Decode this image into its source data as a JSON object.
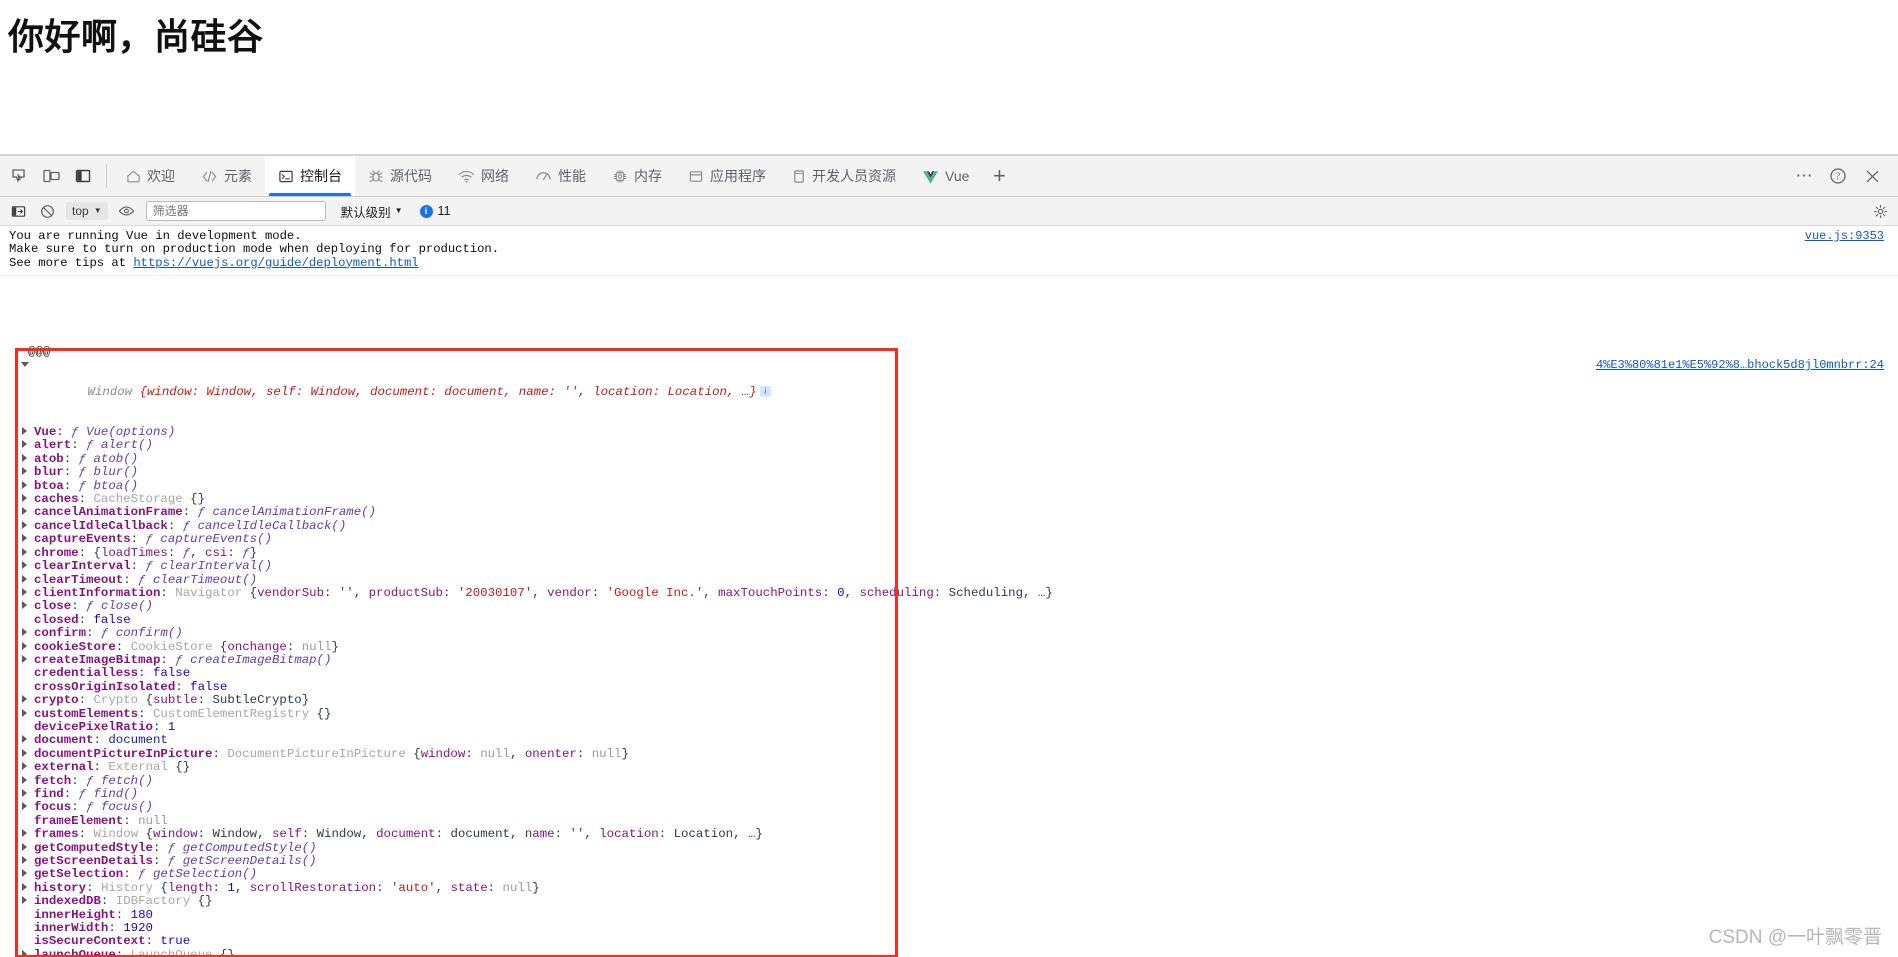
{
  "page": {
    "heading": "你好啊，尚硅谷"
  },
  "devtools": {
    "left_icons": [
      {
        "name": "inspect-element-icon",
        "label": "检查元素"
      },
      {
        "name": "device-toolbar-icon",
        "label": "切换设备工具栏"
      },
      {
        "name": "dock-side-icon",
        "label": "停靠位置"
      }
    ],
    "tabs": [
      {
        "label": "欢迎",
        "icon": "home-icon",
        "active": false
      },
      {
        "label": "元素",
        "icon": "code-brackets-icon",
        "active": false
      },
      {
        "label": "控制台",
        "icon": "console-prompt-icon",
        "active": true
      },
      {
        "label": "源代码",
        "icon": "bug-icon",
        "active": false
      },
      {
        "label": "网络",
        "icon": "wifi-icon",
        "active": false
      },
      {
        "label": "性能",
        "icon": "speedometer-icon",
        "active": false
      },
      {
        "label": "内存",
        "icon": "chip-icon",
        "active": false
      },
      {
        "label": "应用程序",
        "icon": "window-icon",
        "active": false
      },
      {
        "label": "开发人员资源",
        "icon": "book-icon",
        "active": false
      },
      {
        "label": "Vue",
        "icon": "vue-logo-icon",
        "active": false
      }
    ],
    "add_tab_label": "+",
    "right_buttons": [
      {
        "name": "more-options-button",
        "label": "⋯"
      },
      {
        "name": "help-button",
        "label": "?"
      },
      {
        "name": "close-devtools-button",
        "label": "✕"
      }
    ],
    "settings_icon": "gear-icon"
  },
  "console_toolbar": {
    "sidebar_icon": "console-sidebar-icon",
    "clear_icon": "clear-console-icon",
    "context_value": "top",
    "eye_icon": "live-expression-icon",
    "filter_placeholder": "筛选器",
    "filter_value": "",
    "level_label": "默认级别",
    "info_count": "11"
  },
  "console": {
    "warning": {
      "lines": [
        "You are running Vue in development mode.",
        "Make sure to turn on production mode when deploying for production."
      ],
      "tip_prefix": "See more tips at ",
      "tip_link": "https://vuejs.org/guide/deployment.html",
      "source": "vue.js:9353"
    },
    "echo_text": "@@@",
    "object_header": {
      "type": "Window",
      "preview": "{window: Window, self: Window, document: document, name: '', location: Location, …}",
      "source": "4%E3%80%81e1%E5%92%8…bhock5d8jl0mnbrr:24"
    },
    "properties": [
      {
        "expandable": true,
        "key": "Vue",
        "kind": "fn",
        "value": "Vue(options)"
      },
      {
        "expandable": true,
        "key": "alert",
        "kind": "fn",
        "value": "alert()"
      },
      {
        "expandable": true,
        "key": "atob",
        "kind": "fn",
        "value": "atob()"
      },
      {
        "expandable": true,
        "key": "blur",
        "kind": "fn",
        "value": "blur()"
      },
      {
        "expandable": true,
        "key": "btoa",
        "kind": "fn",
        "value": "btoa()"
      },
      {
        "expandable": true,
        "key": "caches",
        "kind": "obj",
        "type": "CacheStorage",
        "value": "{}"
      },
      {
        "expandable": true,
        "key": "cancelAnimationFrame",
        "kind": "fn",
        "value": "cancelAnimationFrame()"
      },
      {
        "expandable": true,
        "key": "cancelIdleCallback",
        "kind": "fn",
        "value": "cancelIdleCallback()"
      },
      {
        "expandable": true,
        "key": "captureEvents",
        "kind": "fn",
        "value": "captureEvents()"
      },
      {
        "expandable": true,
        "key": "chrome",
        "kind": "chrome",
        "value": "{loadTimes: ƒ, csi: ƒ}"
      },
      {
        "expandable": true,
        "key": "clearInterval",
        "kind": "fn",
        "value": "clearInterval()"
      },
      {
        "expandable": true,
        "key": "clearTimeout",
        "kind": "fn",
        "value": "clearTimeout()"
      },
      {
        "expandable": true,
        "key": "clientInformation",
        "kind": "navigator",
        "type": "Navigator",
        "value": "{vendorSub: '', productSub: '20030107', vendor: 'Google Inc.', maxTouchPoints: 0, scheduling: Scheduling, …}"
      },
      {
        "expandable": true,
        "key": "close",
        "kind": "fn",
        "value": "close()"
      },
      {
        "expandable": false,
        "key": "closed",
        "kind": "bool",
        "value": "false"
      },
      {
        "expandable": true,
        "key": "confirm",
        "kind": "fn",
        "value": "confirm()"
      },
      {
        "expandable": true,
        "key": "cookieStore",
        "kind": "objnull",
        "type": "CookieStore",
        "value": "{onchange: null}"
      },
      {
        "expandable": true,
        "key": "createImageBitmap",
        "kind": "fn",
        "value": "createImageBitmap()"
      },
      {
        "expandable": false,
        "key": "credentialless",
        "kind": "bool",
        "value": "false"
      },
      {
        "expandable": false,
        "key": "crossOriginIsolated",
        "kind": "bool",
        "value": "false"
      },
      {
        "expandable": true,
        "key": "crypto",
        "kind": "crypto",
        "type": "Crypto",
        "value": "{subtle: SubtleCrypto}"
      },
      {
        "expandable": true,
        "key": "customElements",
        "kind": "obj",
        "type": "CustomElementRegistry",
        "value": "{}"
      },
      {
        "expandable": false,
        "key": "devicePixelRatio",
        "kind": "num",
        "value": "1"
      },
      {
        "expandable": true,
        "key": "document",
        "kind": "elem",
        "value": "document"
      },
      {
        "expandable": true,
        "key": "documentPictureInPicture",
        "kind": "dpip",
        "type": "DocumentPictureInPicture",
        "value": "{window: null, onenter: null}"
      },
      {
        "expandable": true,
        "key": "external",
        "kind": "obj",
        "type": "External",
        "value": "{}"
      },
      {
        "expandable": true,
        "key": "fetch",
        "kind": "fn",
        "value": "fetch()"
      },
      {
        "expandable": true,
        "key": "find",
        "kind": "fn",
        "value": "find()"
      },
      {
        "expandable": true,
        "key": "focus",
        "kind": "fn",
        "value": "focus()"
      },
      {
        "expandable": false,
        "key": "frameElement",
        "kind": "null",
        "value": "null"
      },
      {
        "expandable": true,
        "key": "frames",
        "kind": "frames",
        "type": "Window",
        "value": "{window: Window, self: Window, document: document, name: '', location: Location, …}"
      },
      {
        "expandable": true,
        "key": "getComputedStyle",
        "kind": "fn",
        "value": "getComputedStyle()"
      },
      {
        "expandable": true,
        "key": "getScreenDetails",
        "kind": "fn",
        "value": "getScreenDetails()"
      },
      {
        "expandable": true,
        "key": "getSelection",
        "kind": "fn",
        "value": "getSelection()"
      },
      {
        "expandable": true,
        "key": "history",
        "kind": "history",
        "type": "History",
        "value": "{length: 1, scrollRestoration: 'auto', state: null}"
      },
      {
        "expandable": true,
        "key": "indexedDB",
        "kind": "obj",
        "type": "IDBFactory",
        "value": "{}"
      },
      {
        "expandable": false,
        "key": "innerHeight",
        "kind": "num",
        "value": "180"
      },
      {
        "expandable": false,
        "key": "innerWidth",
        "kind": "num",
        "value": "1920"
      },
      {
        "expandable": false,
        "key": "isSecureContext",
        "kind": "bool",
        "value": "true"
      },
      {
        "expandable": true,
        "key": "launchQueue",
        "kind": "obj",
        "type": "LaunchQueue",
        "value": "{}"
      }
    ]
  },
  "watermark": "CSDN @一叶飘零晋",
  "colors": {
    "accent": "#1a73e8",
    "annotation_box": "#fb2a1c",
    "link": "#1155cc",
    "property_key": "#881280",
    "string_value": "#c41a16",
    "number_value": "#1c00cf"
  }
}
